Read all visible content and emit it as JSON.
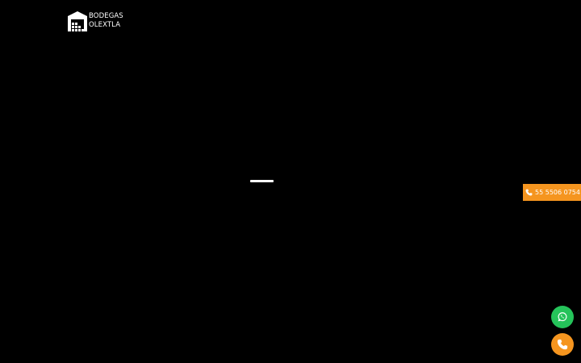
{
  "brand": {
    "line1": "BODEGAS",
    "line2": "OLEXTLA",
    "icon": "warehouse-icon"
  },
  "loader": {
    "icon": "loading-bar"
  },
  "contact": {
    "phone_label": "55 5506 0754",
    "phone_icon": "phone-icon",
    "whatsapp_icon": "whatsapp-icon",
    "call_icon": "phone-icon"
  },
  "colors": {
    "background": "#000000",
    "accent": "#f5951f",
    "whatsapp": "#25c35a",
    "text": "#ffffff"
  }
}
